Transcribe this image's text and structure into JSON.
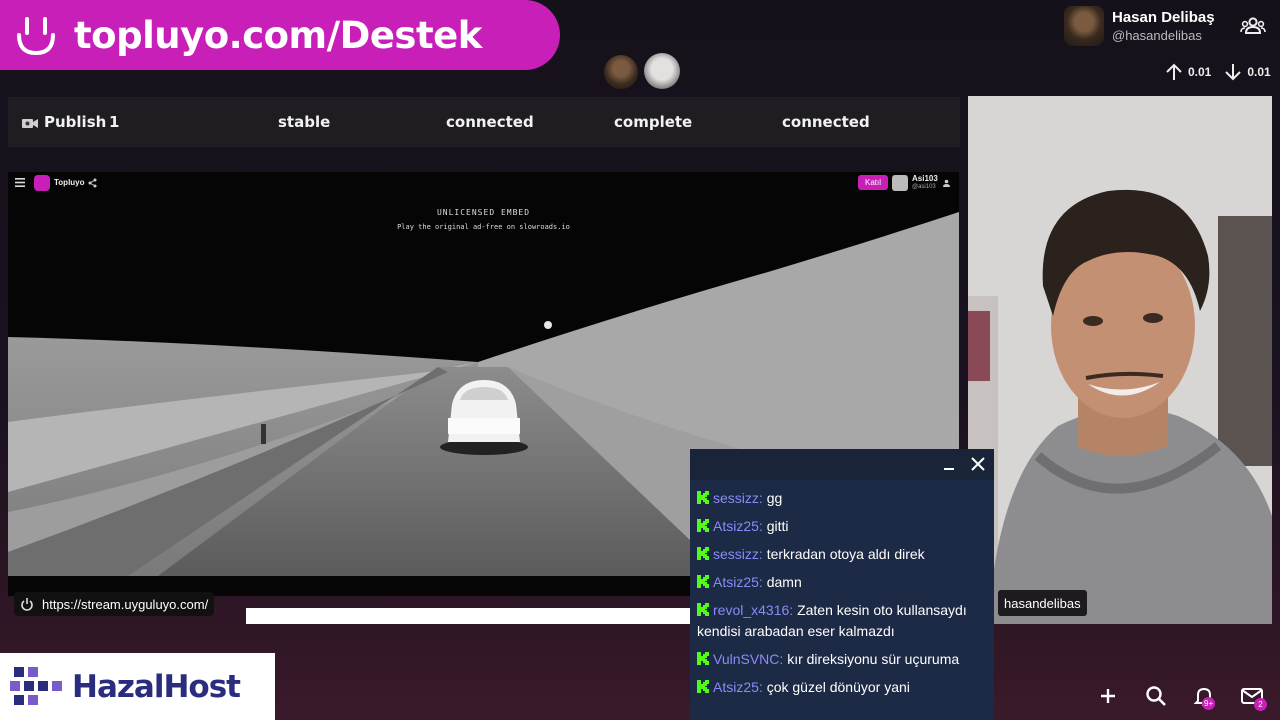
{
  "banner": {
    "text": "topluyo.com/Destek"
  },
  "user": {
    "name": "Hasan Delibaş",
    "handle": "@hasandelibas"
  },
  "stats": {
    "upload": "0.01",
    "download": "0.01"
  },
  "status_bar": {
    "publish_label": "Publish",
    "publish_count": "1",
    "items": [
      "stable",
      "connected",
      "complete",
      "connected"
    ]
  },
  "embed": {
    "app_name": "Topluyo",
    "join_button": "Katıl",
    "user_name": "Asi103",
    "user_handle": "@asi103",
    "notice_title": "UNLICENSED EMBED",
    "notice_sub": "Play the original ad-free on slowroads.io"
  },
  "url_bar": {
    "url": "https://stream.uyguluyo.com/"
  },
  "webcam": {
    "label": "hasandelibas"
  },
  "chat": {
    "messages": [
      {
        "user": "sessizz",
        "text": "gg"
      },
      {
        "user": "Atsiz25",
        "text": "gitti"
      },
      {
        "user": "sessizz",
        "text": "terkradan otoya aldı direk"
      },
      {
        "user": "Atsiz25",
        "text": "damn"
      },
      {
        "user": "revol_x4316",
        "text": "Zaten kesin oto kullansaydı kendisi arabadan eser kalmazdı"
      },
      {
        "user": "VulnSVNC",
        "text": "kır direksiyonu sür uçuruma"
      },
      {
        "user": "Atsiz25",
        "text": "çok güzel dönüyor yani"
      }
    ]
  },
  "logo": {
    "text": "HazalHost"
  },
  "notifications": {
    "badge": "9+"
  },
  "mail": {
    "badge": "2"
  },
  "colors": {
    "brand": "#c71fb8",
    "chat_bg": "#1c2a45",
    "chat_user": "#8b8bf5",
    "kick_green": "#53fc18"
  }
}
